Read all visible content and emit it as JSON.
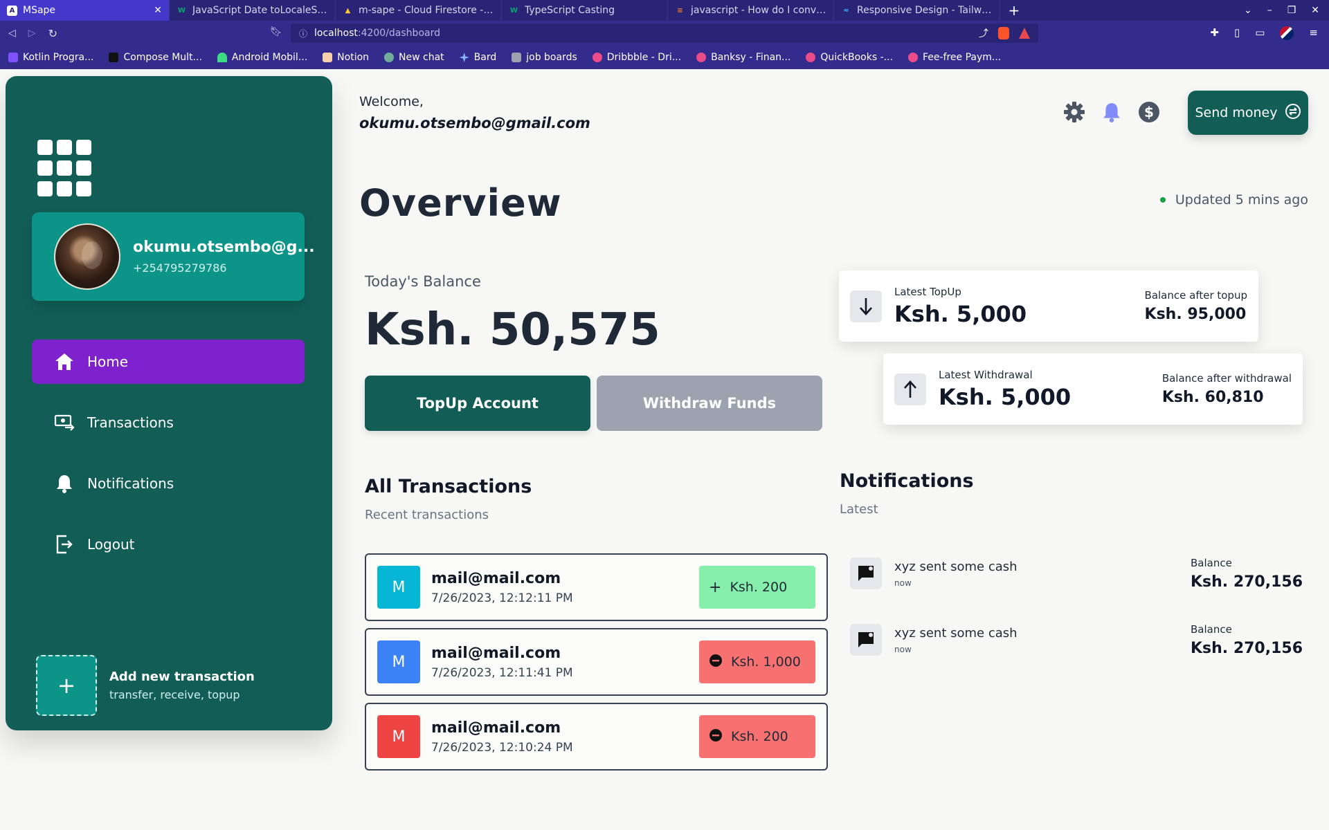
{
  "browser": {
    "tabs": [
      {
        "title": "MSape",
        "active": true
      },
      {
        "title": "JavaScript Date toLocaleStrin"
      },
      {
        "title": "m-sape - Cloud Firestore - Fire"
      },
      {
        "title": "TypeScript Casting"
      },
      {
        "title": "javascript - How do I convert a"
      },
      {
        "title": "Responsive Design - Tailwind"
      }
    ],
    "url_host": "localhost",
    "url_path": ":4200/dashboard",
    "bookmarks": [
      {
        "label": "Kotlin Progra...",
        "color": "#7f52ff"
      },
      {
        "label": "Compose Mult...",
        "color": "#111111"
      },
      {
        "label": "Android Mobil...",
        "color": "#3ddc84"
      },
      {
        "label": "Notion",
        "color": "#f5d0a9"
      },
      {
        "label": "New chat",
        "color": "#74aa9c"
      },
      {
        "label": "Bard",
        "color": "#8ab4f8"
      },
      {
        "label": "job boards",
        "color": "#9ca3af"
      },
      {
        "label": "Dribbble - Dri...",
        "color": "#ea4c89"
      },
      {
        "label": "Banksy - Finan...",
        "color": "#ea4c89"
      },
      {
        "label": "QuickBooks -...",
        "color": "#ea4c89"
      },
      {
        "label": "Fee-free Paym...",
        "color": "#ea4c89"
      }
    ]
  },
  "sidebar": {
    "profile": {
      "name": "okumu.otsembo@g...",
      "phone": "+254795279786"
    },
    "nav": [
      {
        "label": "Home",
        "icon": "home-icon",
        "active": true
      },
      {
        "label": "Transactions",
        "icon": "transactions-icon"
      },
      {
        "label": "Notifications",
        "icon": "bell-icon"
      },
      {
        "label": "Logout",
        "icon": "logout-icon"
      }
    ],
    "add_transaction": {
      "title": "Add new transaction",
      "subtitle": "transfer, receive, topup"
    }
  },
  "header": {
    "welcome": "Welcome,",
    "email": "okumu.otsembo@gmail.com",
    "send_money": "Send money"
  },
  "overview": {
    "title": "Overview",
    "updated": "Updated 5 mins ago",
    "balance_label": "Today's Balance",
    "balance_value": "Ksh. 50,575",
    "topup_button": "TopUp Account",
    "withdraw_button": "Withdraw Funds"
  },
  "latest_topup": {
    "label": "Latest TopUp",
    "value": "Ksh. 5,000",
    "right_label": "Balance after topup",
    "right_value": "Ksh. 95,000"
  },
  "latest_withdrawal": {
    "label": "Latest Withdrawal",
    "value": "Ksh. 5,000",
    "right_label": "Balance after withdrawal",
    "right_value": "Ksh. 60,810"
  },
  "transactions": {
    "title": "All Transactions",
    "subtitle": "Recent transactions",
    "items": [
      {
        "initial": "M",
        "email": "mail@mail.com",
        "date": "7/26/2023, 12:12:11 PM",
        "amount": "Ksh. 200",
        "type": "credit",
        "avatar_color": "#06b6d4"
      },
      {
        "initial": "M",
        "email": "mail@mail.com",
        "date": "7/26/2023, 12:11:41 PM",
        "amount": "Ksh. 1,000",
        "type": "debit",
        "avatar_color": "#3b82f6"
      },
      {
        "initial": "M",
        "email": "mail@mail.com",
        "date": "7/26/2023, 12:10:24 PM",
        "amount": "Ksh. 200",
        "type": "debit",
        "avatar_color": "#ef4444"
      }
    ]
  },
  "notifications": {
    "title": "Notifications",
    "subtitle": "Latest",
    "items": [
      {
        "text": "xyz sent some cash",
        "time": "now",
        "balance_label": "Balance",
        "balance_value": "Ksh. 270,156"
      },
      {
        "text": "xyz sent some cash",
        "time": "now",
        "balance_label": "Balance",
        "balance_value": "Ksh. 270,156"
      }
    ]
  },
  "colors": {
    "primary": "#125e57",
    "accent_teal": "#0d9488",
    "active_nav": "#7e22ce",
    "credit": "#86efac",
    "debit": "#f87171",
    "status_dot": "#16a34a"
  }
}
